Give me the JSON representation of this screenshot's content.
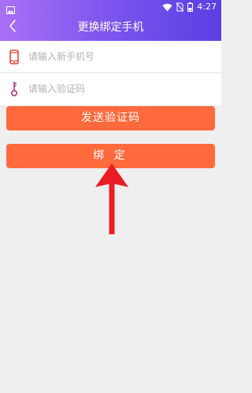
{
  "status_bar": {
    "time": "4:27",
    "left_icon": "image-icon",
    "right_icons": [
      "wifi-icon",
      "no-sim-icon",
      "battery-icon"
    ]
  },
  "header": {
    "title": "更换绑定手机",
    "back_icon": "back-chevron-icon"
  },
  "form": {
    "phone": {
      "icon": "phone-icon",
      "placeholder": "请输入新手机号",
      "value": ""
    },
    "code": {
      "icon": "key-icon",
      "placeholder": "请输入验证码",
      "value": ""
    }
  },
  "buttons": {
    "send_code_label": "发送验证码",
    "bind_label": "绑 定"
  },
  "annotation": {
    "icon": "red-arrow-up-icon"
  },
  "colors": {
    "header_gradient_start": "#a970f5",
    "header_gradient_end": "#5a3fe3",
    "button_orange": "#ff6a3d",
    "background": "#efefef",
    "icon_red": "#e8433a",
    "key_purple": "#b0307a",
    "arrow_red": "#ea1c24"
  }
}
